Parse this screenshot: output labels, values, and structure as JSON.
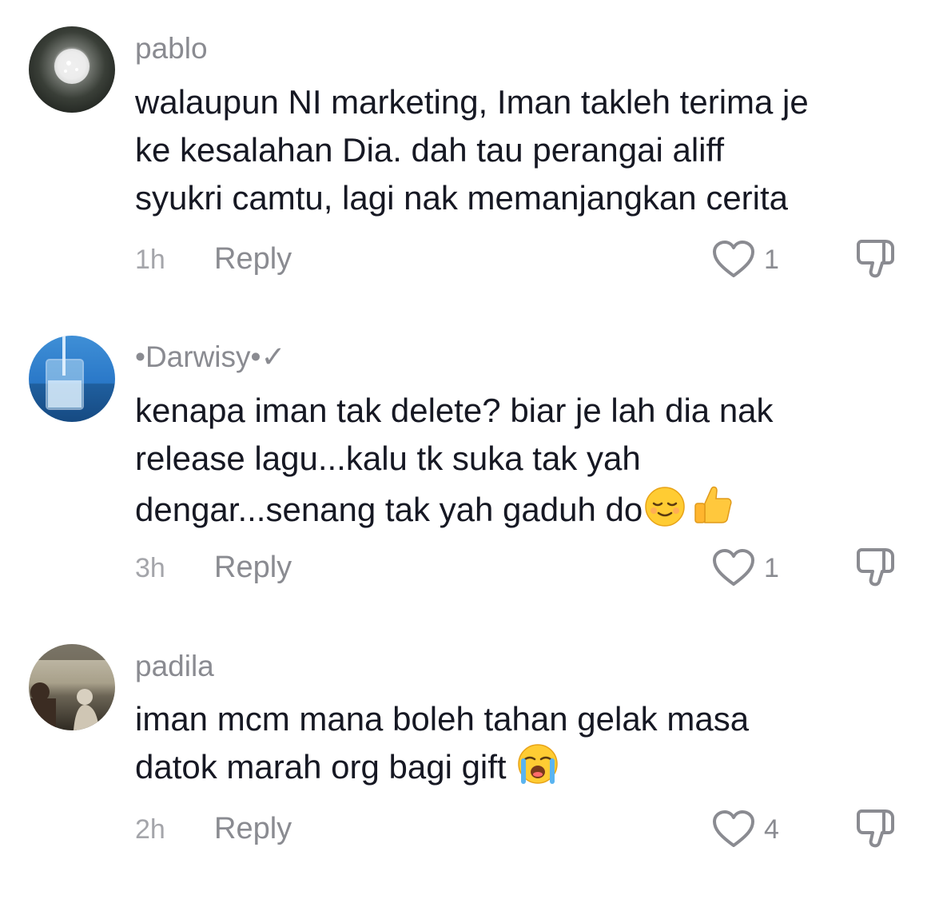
{
  "comments": [
    {
      "username": "pablo",
      "lines": [
        "walaupun NI marketing, Iman takleh terima je",
        "ke kesalahan Dia. dah tau perangai aliff",
        "syukri camtu, lagi nak memanjangkan cerita"
      ],
      "time": "1h",
      "reply_label": "Reply",
      "likes": "1",
      "avatar_icon": "sparkle-dot-avatar"
    },
    {
      "username": "•Darwisy•✓",
      "lines": [
        "kenapa iman tak delete? biar je lah dia nak",
        "release lagu...kalu tk suka tak yah",
        "dengar...senang tak yah gaduh do"
      ],
      "line_emojis": [
        "relieved-face-emoji",
        "thumbs-up-emoji"
      ],
      "time": "3h",
      "reply_label": "Reply",
      "likes": "1",
      "avatar_icon": "water-glass-avatar"
    },
    {
      "username": "padila",
      "lines": [
        "iman mcm mana boleh tahan gelak masa",
        "datok marah org bagi gift"
      ],
      "line_emojis": [
        "loudly-crying-face-emoji"
      ],
      "time": "2h",
      "reply_label": "Reply",
      "likes": "4",
      "avatar_icon": "sunset-people-avatar"
    }
  ],
  "icons": {
    "like": "heart-outline-icon",
    "dislike": "thumbs-down-outline-icon"
  },
  "colors": {
    "text": "#161823",
    "secondary": "#8a8b91",
    "muted": "#a4a5aa",
    "background": "#ffffff"
  }
}
